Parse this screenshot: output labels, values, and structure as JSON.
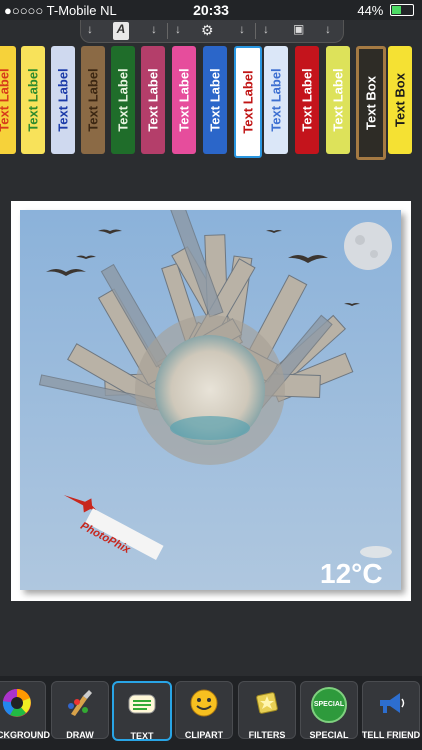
{
  "status": {
    "carrier": "●○○○○ T-Mobile NL",
    "time": "20:33",
    "battery": "44%"
  },
  "topbar": {
    "tabs": [
      "↓",
      "A",
      "↓",
      "↓",
      "⚙",
      "↓",
      "↓",
      "▣",
      "↓"
    ]
  },
  "labels": [
    {
      "text": "Text Label",
      "bg": "#f6d23a",
      "fg": "#d63a1a"
    },
    {
      "text": "Text Label",
      "bg": "#f8e25a",
      "fg": "#2d8a2e"
    },
    {
      "text": "Text Label",
      "bg": "#cfd9ef",
      "fg": "#1a3aa8"
    },
    {
      "text": "Text Label",
      "bg": "#8b6a45",
      "fg": "#3b2612"
    },
    {
      "text": "Text Label",
      "bg": "#1f6d2a",
      "fg": "#e8f5e0"
    },
    {
      "text": "Text Label",
      "bg": "#b43e6a",
      "fg": "#ffffff"
    },
    {
      "text": "Text Label",
      "bg": "#e64d9c",
      "fg": "#ffffff"
    },
    {
      "text": "Text Label",
      "bg": "#2b66c9",
      "fg": "#ffffff"
    },
    {
      "text": "Text Label",
      "bg": "#ffffff",
      "fg": "#c01414"
    },
    {
      "text": "Text Label",
      "bg": "#dbe7f8",
      "fg": "#3c6fd1"
    },
    {
      "text": "Text Label",
      "bg": "#c4141c",
      "fg": "#ffffff"
    },
    {
      "text": "Text Label",
      "bg": "#dde25a",
      "fg": "#ffffff"
    },
    {
      "text": "Text Box",
      "bg": "#2e2c26",
      "fg": "#ffffff"
    },
    {
      "text": "Text Box",
      "bg": "#f5e133",
      "fg": "#1a1a1a"
    }
  ],
  "photo": {
    "temperature": "12°C",
    "banner": "PhotoPhix"
  },
  "toolbar": {
    "items": [
      {
        "label": "BACKGROUND"
      },
      {
        "label": "DRAW"
      },
      {
        "label": "TEXT"
      },
      {
        "label": "CLIPART"
      },
      {
        "label": "FILTERS"
      },
      {
        "label": "SPECIAL"
      },
      {
        "label": "TELL FRIEND"
      }
    ],
    "special_badge": "SPECIAL",
    "selected": "TEXT"
  }
}
